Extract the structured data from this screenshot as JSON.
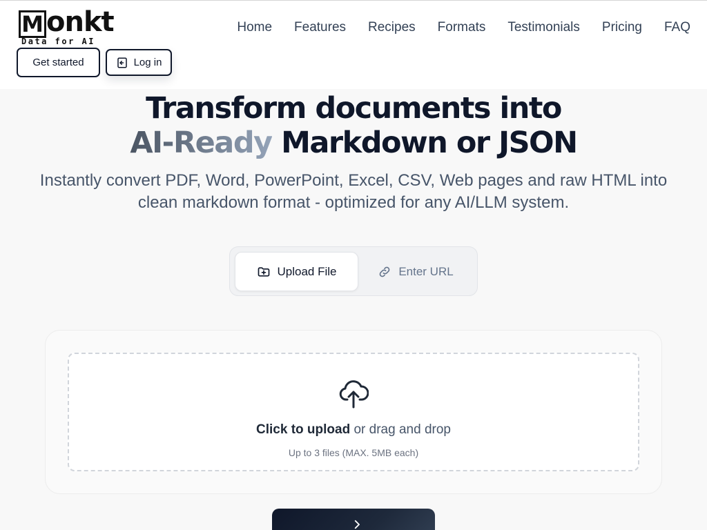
{
  "brand": {
    "logo_mark": "M",
    "name": "onkt",
    "tagline": "Data for AI"
  },
  "nav": {
    "items": [
      {
        "label": "Home"
      },
      {
        "label": "Features"
      },
      {
        "label": "Recipes"
      },
      {
        "label": "Formats"
      },
      {
        "label": "Testimonials"
      },
      {
        "label": "Pricing"
      },
      {
        "label": "FAQ"
      }
    ]
  },
  "header_actions": {
    "get_started": "Get started",
    "login": "Log in",
    "login_icon": "login-icon"
  },
  "hero": {
    "title_line1": "Transform documents into",
    "title_highlight": "AI-Ready",
    "title_line2_rest": " Markdown or JSON",
    "subtitle": "Instantly convert PDF, Word, PowerPoint, Excel, CSV, Web pages and raw HTML into clean markdown format - optimized for any AI/LLM system."
  },
  "input_tabs": [
    {
      "label": "Upload File",
      "icon": "folder-plus-icon",
      "active": true
    },
    {
      "label": "Enter URL",
      "icon": "link-icon",
      "active": false
    }
  ],
  "upload": {
    "icon": "cloud-upload-icon",
    "cta_bold": "Click to upload",
    "cta_rest": " or drag and drop",
    "hint": "Up to 3 files (MAX. 5MB each)"
  },
  "transform_button": {
    "label": "",
    "icon": "arrow-right-icon"
  },
  "colors": {
    "primary": "#0f172a",
    "muted_text": "#475569",
    "page_bg": "#f8f8f8"
  }
}
